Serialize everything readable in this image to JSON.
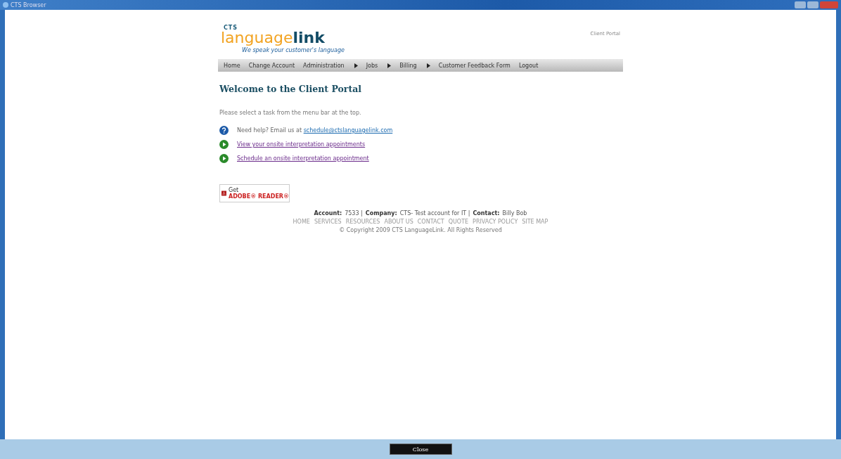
{
  "window": {
    "title": "CTS Browser"
  },
  "logo": {
    "small": "CTS",
    "part1": "language",
    "part2": "link",
    "tagline": "We speak your customer's language"
  },
  "header_link": "Client Portal",
  "menu": [
    {
      "label": "Home",
      "has_submenu": false
    },
    {
      "label": "Change Account",
      "has_submenu": false
    },
    {
      "label": "Administration",
      "has_submenu": true
    },
    {
      "label": "Jobs",
      "has_submenu": true
    },
    {
      "label": "Billing",
      "has_submenu": true
    },
    {
      "label": "Customer Feedback Form",
      "has_submenu": false
    },
    {
      "label": "Logout",
      "has_submenu": false
    }
  ],
  "heading": "Welcome to the Client Portal",
  "intro": "Please select a task from the menu bar at the top.",
  "actions": [
    {
      "kind": "help",
      "text": "Need help? Email us at ",
      "link": "schedule@ctslanguagelink.com"
    },
    {
      "kind": "go",
      "link": "View your onsite interpretation appointments"
    },
    {
      "kind": "go",
      "link": "Schedule an onsite interpretation appointment"
    }
  ],
  "adobe_badge": {
    "line1": "Get",
    "line2": "ADOBE® READER®"
  },
  "footer": {
    "account_label": "Account:",
    "account": "7533 |",
    "company_label": "Company:",
    "company": "CTS- Test account for IT |",
    "contact_label": "Contact:",
    "contact": "Billy Bob",
    "links": [
      "HOME",
      "SERVICES",
      "RESOURCES",
      "ABOUT US",
      "CONTACT",
      "QUOTE",
      "PRIVACY POLICY",
      "SITE MAP"
    ],
    "copyright": "© Copyright 2009 CTS LanguageLink. All Rights Reserved"
  },
  "close_button": "Close"
}
